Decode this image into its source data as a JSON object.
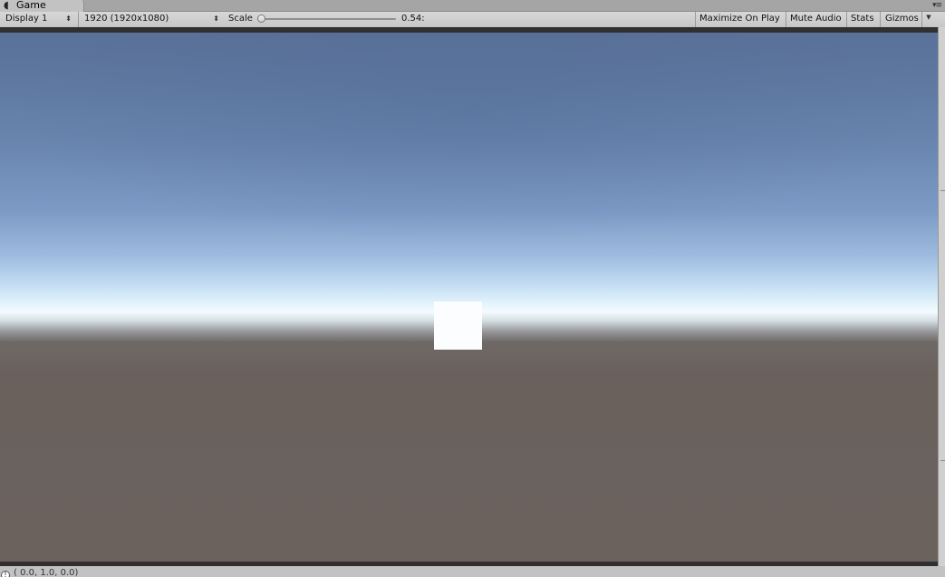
{
  "tab": {
    "icon": "game-controller-icon",
    "label": "Game",
    "menu_icon": "▾≡"
  },
  "toolbar": {
    "display_label": "Display 1",
    "resolution_label": "1920 (1920x1080)",
    "dropdown_arrow": "⬍",
    "scale_label": "Scale",
    "scale_value_text": "0.54:",
    "scale_level": 0.0,
    "maximize_label": "Maximize On Play",
    "mute_label": "Mute Audio",
    "stats_label": "Stats",
    "gizmos_label": "Gizmos",
    "gizmos_arrow": "▼"
  },
  "viewport": {
    "sky_color_top": "#5a7198",
    "horizon_color": "#f4fbff",
    "ground_color": "#6b625e",
    "cube_color": "#fcfdff"
  },
  "status": {
    "icon": "info-icon",
    "icon_glyph": "!",
    "text": "( 0.0, 1.0, 0.0)"
  }
}
